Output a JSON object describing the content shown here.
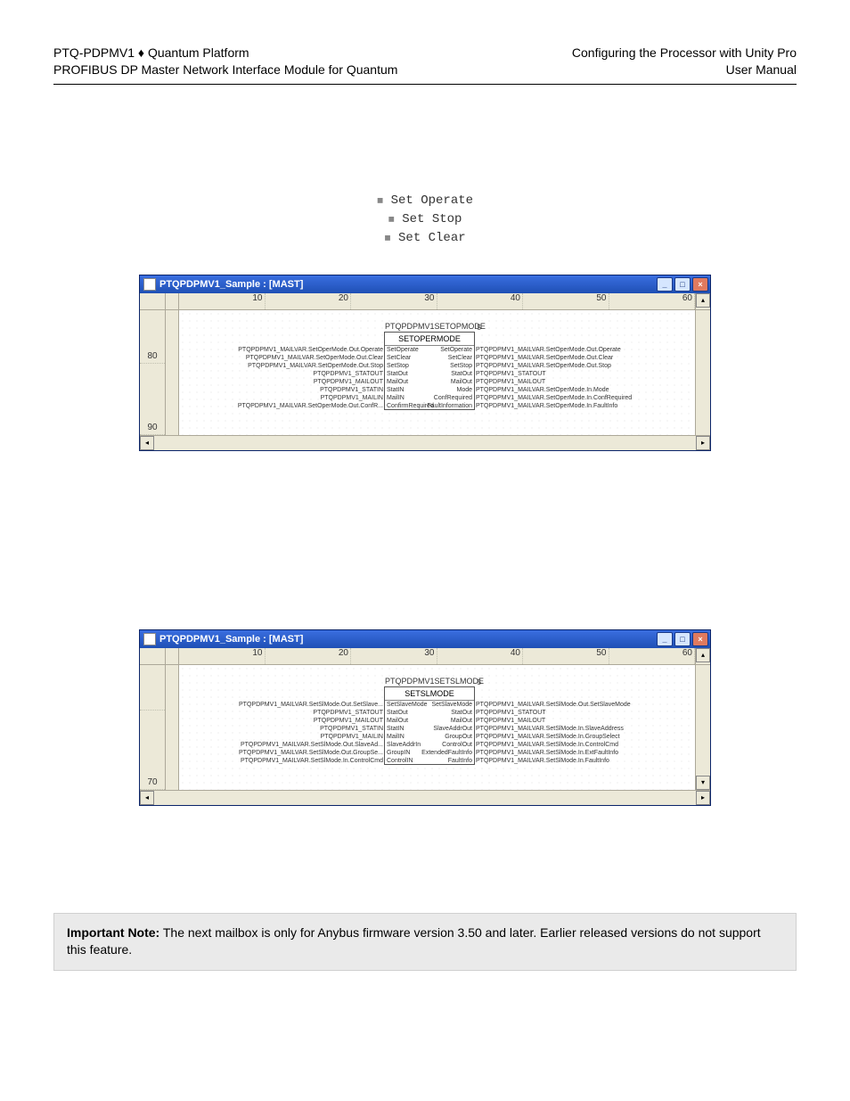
{
  "header": {
    "left1_a": "PTQ-PDPMV1",
    "left1_sep": " ♦ ",
    "left1_b": "Quantum Platform",
    "left2": "PROFIBUS DP Master Network Interface Module for Quantum",
    "right1": "Configuring the Processor with Unity Pro",
    "right2": "User Manual"
  },
  "set_list": {
    "items": [
      "Set Operate",
      "Set Stop",
      "Set Clear"
    ]
  },
  "window1": {
    "title": "PTQPDPMV1_Sample : [MAST]",
    "ruler": [
      "10",
      "20",
      "30",
      "40",
      "50",
      "60"
    ],
    "rows": [
      "80",
      "90"
    ],
    "block": {
      "name": "PTQPDPMV1SETOPMODE",
      "label": "SETOPERMODE",
      "inst": "5",
      "left_wires": [
        "PTQPDPMV1_MAILVAR.SetOperMode.Out.Operate",
        "PTQPDPMV1_MAILVAR.SetOperMode.Out.Clear",
        "PTQPDPMV1_MAILVAR.SetOperMode.Out.Stop",
        "PTQPDPMV1_STATOUT",
        "PTQPDPMV1_MAILOUT",
        "PTQPDPMV1_STATIN",
        "PTQPDPMV1_MAILIN",
        "PTQPDPMV1_MAILVAR.SetOperMode.Out.ConfR..."
      ],
      "left_pins": [
        "SetOperate",
        "SetClear",
        "SetStop",
        "StatOut",
        "MailOut",
        "StatIN",
        "MailIN",
        "ConfirmRequired"
      ],
      "right_pins": [
        "SetOperate",
        "SetClear",
        "SetStop",
        "StatOut",
        "MailOut",
        "Mode",
        "ConfRequired",
        "FaultInformation"
      ],
      "right_wires": [
        "PTQPDPMV1_MAILVAR.SetOperMode.Out.Operate",
        "PTQPDPMV1_MAILVAR.SetOperMode.Out.Clear",
        "PTQPDPMV1_MAILVAR.SetOperMode.Out.Stop",
        "PTQPDPMV1_STATOUT",
        "PTQPDPMV1_MAILOUT",
        "PTQPDPMV1_MAILVAR.SetOperMode.In.Mode",
        "PTQPDPMV1_MAILVAR.SetOperMode.In.ConfRequired",
        "PTQPDPMV1_MAILVAR.SetOperMode.In.FaultInfo"
      ]
    }
  },
  "window2": {
    "title": "PTQPDPMV1_Sample : [MAST]",
    "ruler": [
      "10",
      "20",
      "30",
      "40",
      "50",
      "60"
    ],
    "rows": [
      "",
      "70"
    ],
    "block": {
      "name": "PTQPDPMV1SETSLMODE",
      "label": "SETSLMODE",
      "inst": "5",
      "left_wires": [
        "PTQPDPMV1_MAILVAR.SetSlMode.Out.SetSlave...",
        "PTQPDPMV1_STATOUT",
        "PTQPDPMV1_MAILOUT",
        "PTQPDPMV1_STATIN",
        "PTQPDPMV1_MAILIN",
        "PTQPDPMV1_MAILVAR.SetSlMode.Out.SlaveAd...",
        "PTQPDPMV1_MAILVAR.SetSlMode.Out.GroupSe...",
        "PTQPDPMV1_MAILVAR.SetSlMode.In.ControlCmd"
      ],
      "left_pins": [
        "SetSlaveMode",
        "StatOut",
        "MailOut",
        "StatIN",
        "MailIN",
        "SlaveAddrIn",
        "GroupIN",
        "ControlIN"
      ],
      "right_pins": [
        "SetSlaveMode",
        "StatOut",
        "MailOut",
        "SlaveAddrOut",
        "GroupOut",
        "ControlOut",
        "ExtendedFaultInfo",
        "FaultInfo"
      ],
      "right_wires": [
        "PTQPDPMV1_MAILVAR.SetSlMode.Out.SetSlaveMode",
        "PTQPDPMV1_STATOUT",
        "PTQPDPMV1_MAILOUT",
        "PTQPDPMV1_MAILVAR.SetSlMode.In.SlaveAddress",
        "PTQPDPMV1_MAILVAR.SetSlMode.In.GroupSelect",
        "PTQPDPMV1_MAILVAR.SetSlMode.In.ControlCmd",
        "PTQPDPMV1_MAILVAR.SetSlMode.In.ExtFaultInfo",
        "PTQPDPMV1_MAILVAR.SetSlMode.In.FaultInfo"
      ]
    }
  },
  "note": {
    "bold": "Important Note:",
    "text": " The next mailbox is only for Anybus firmware version 3.50 and later. Earlier released versions do not support this feature."
  }
}
